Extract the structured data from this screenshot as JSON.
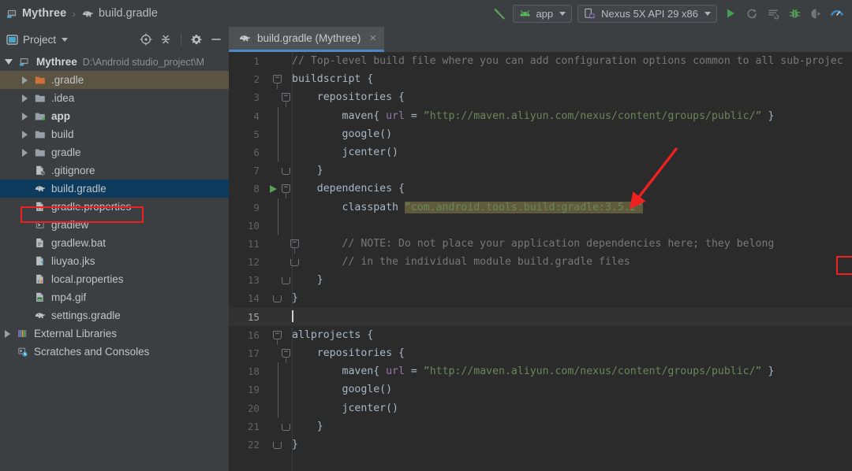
{
  "breadcrumb": {
    "project": "Mythree",
    "separator": "›",
    "file": "build.gradle",
    "project_icon": "module-icon",
    "file_icon": "gradle-elephant-icon"
  },
  "toolbar": {
    "build_icon": "hammer-icon",
    "run_config": {
      "label": "app",
      "icon": "android-head-icon",
      "caret": "chevron-down-icon"
    },
    "device": {
      "label": "Nexus 5X API 29 x86",
      "icon": "device-phone-icon",
      "caret": "chevron-down-icon"
    },
    "actions": [
      {
        "name": "run-button",
        "icon": "play-icon",
        "color": "#499c54"
      },
      {
        "name": "apply-changes-button",
        "icon": "apply-changes-icon",
        "color": "#6e7275"
      },
      {
        "name": "apply-code-changes-button",
        "icon": "apply-code-changes-icon",
        "color": "#6e7275"
      },
      {
        "name": "debug-button",
        "icon": "bug-icon",
        "color": "#57965c"
      },
      {
        "name": "attach-debugger-button",
        "icon": "attach-debugger-icon",
        "color": "#6e7275"
      },
      {
        "name": "profiler-button",
        "icon": "profiler-gauge-icon",
        "color": "#3d8ac4"
      }
    ]
  },
  "panel": {
    "title": "Project",
    "caret": "chevron-down-icon",
    "tools": [
      {
        "name": "select-opened-file-button",
        "icon": "target-crosshair-icon"
      },
      {
        "name": "collapse-all-button",
        "icon": "collapse-all-icon"
      },
      {
        "name": "settings-button",
        "icon": "gear-icon"
      },
      {
        "name": "hide-button",
        "icon": "minimize-icon"
      }
    ],
    "tree": [
      {
        "label": "Mythree",
        "path": "D:\\Android studio_project\\M",
        "icon": "module-icon",
        "expander": "down",
        "indent": 0,
        "bold": true,
        "state": "normal"
      },
      {
        "label": ".gradle",
        "icon": "folder-orange-icon",
        "expander": "right",
        "indent": 1,
        "bold": false,
        "state": "hover"
      },
      {
        "label": ".idea",
        "icon": "folder-icon",
        "expander": "right",
        "indent": 1,
        "bold": false,
        "state": "normal"
      },
      {
        "label": "app",
        "icon": "folder-module-icon",
        "expander": "right",
        "indent": 1,
        "bold": true,
        "state": "normal"
      },
      {
        "label": "build",
        "icon": "folder-icon",
        "expander": "right",
        "indent": 1,
        "bold": false,
        "state": "normal"
      },
      {
        "label": "gradle",
        "icon": "folder-icon",
        "expander": "right",
        "indent": 1,
        "bold": false,
        "state": "normal"
      },
      {
        "label": ".gitignore",
        "icon": "gitignore-file-icon",
        "expander": "none",
        "indent": 1,
        "bold": false,
        "state": "normal"
      },
      {
        "label": "build.gradle",
        "icon": "gradle-elephant-icon",
        "expander": "none",
        "indent": 1,
        "bold": false,
        "state": "selected"
      },
      {
        "label": "gradle.properties",
        "icon": "properties-file-icon",
        "expander": "none",
        "indent": 1,
        "bold": false,
        "state": "normal"
      },
      {
        "label": "gradlew",
        "icon": "script-file-icon",
        "expander": "none",
        "indent": 1,
        "bold": false,
        "state": "normal"
      },
      {
        "label": "gradlew.bat",
        "icon": "bat-file-icon",
        "expander": "none",
        "indent": 1,
        "bold": false,
        "state": "normal"
      },
      {
        "label": "liuyao.jks",
        "icon": "unknown-file-icon",
        "expander": "none",
        "indent": 1,
        "bold": false,
        "state": "normal"
      },
      {
        "label": "local.properties",
        "icon": "properties-file-icon",
        "expander": "none",
        "indent": 1,
        "bold": false,
        "state": "normal"
      },
      {
        "label": "mp4.gif",
        "icon": "image-file-icon",
        "expander": "none",
        "indent": 1,
        "bold": false,
        "state": "normal"
      },
      {
        "label": "settings.gradle",
        "icon": "gradle-elephant-icon",
        "expander": "none",
        "indent": 1,
        "bold": false,
        "state": "normal"
      },
      {
        "label": "External Libraries",
        "icon": "libraries-icon",
        "expander": "right",
        "indent": 0,
        "bold": false,
        "state": "normal"
      },
      {
        "label": "Scratches and Consoles",
        "icon": "scratches-icon",
        "expander": "none",
        "indent": 0,
        "bold": false,
        "state": "normal"
      }
    ]
  },
  "editor": {
    "tab": {
      "label": "build.gradle (Mythree)",
      "icon": "gradle-elephant-icon",
      "close": "×"
    },
    "lines": [
      {
        "n": "1",
        "segments": [
          {
            "t": "// Top-level build file where you can add configuration options common to all sub-projec",
            "c": "c-cmt"
          }
        ]
      },
      {
        "n": "2",
        "segments": [
          {
            "t": "buildscript {",
            "c": "c-pln"
          }
        ]
      },
      {
        "n": "3",
        "segments": [
          {
            "t": "    repositories {",
            "c": "c-pln"
          }
        ]
      },
      {
        "n": "4",
        "segments": [
          {
            "t": "        maven",
            "c": "c-pln"
          },
          {
            "t": "{ ",
            "c": "c-punc"
          },
          {
            "t": "url",
            "c": "c-attr"
          },
          {
            "t": " = ",
            "c": "c-pln"
          },
          {
            "t": "”http://maven.aliyun.com/nexus/content/groups/public/”",
            "c": "c-str"
          },
          {
            "t": " }",
            "c": "c-punc"
          }
        ]
      },
      {
        "n": "5",
        "segments": [
          {
            "t": "        google()",
            "c": "c-pln"
          }
        ]
      },
      {
        "n": "6",
        "segments": [
          {
            "t": "        jcenter()",
            "c": "c-pln"
          }
        ]
      },
      {
        "n": "7",
        "segments": [
          {
            "t": "    }",
            "c": "c-pln"
          }
        ]
      },
      {
        "n": "8",
        "segments": [
          {
            "t": "    dependencies {",
            "c": "c-pln"
          }
        ]
      },
      {
        "n": "9",
        "segments": [
          {
            "t": "        classpath ",
            "c": "c-pln"
          },
          {
            "t": "”com.android.tools.build:gradle:3.5.2”",
            "c": "c-str sel"
          }
        ]
      },
      {
        "n": "10",
        "segments": [
          {
            "t": "",
            "c": "c-pln"
          }
        ]
      },
      {
        "n": "11",
        "segments": [
          {
            "t": "        // NOTE: Do not place your application dependencies here; they belong",
            "c": "c-cmt"
          }
        ]
      },
      {
        "n": "12",
        "segments": [
          {
            "t": "        // in the individual module build.gradle files",
            "c": "c-cmt"
          }
        ]
      },
      {
        "n": "13",
        "segments": [
          {
            "t": "    }",
            "c": "c-pln"
          }
        ]
      },
      {
        "n": "14",
        "segments": [
          {
            "t": "}",
            "c": "c-pln"
          }
        ]
      },
      {
        "n": "15",
        "segments": [
          {
            "t": "",
            "c": "c-pln"
          }
        ]
      },
      {
        "n": "16",
        "segments": [
          {
            "t": "allprojects {",
            "c": "c-pln"
          }
        ]
      },
      {
        "n": "17",
        "segments": [
          {
            "t": "    repositories {",
            "c": "c-pln"
          }
        ]
      },
      {
        "n": "18",
        "segments": [
          {
            "t": "        maven",
            "c": "c-pln"
          },
          {
            "t": "{ ",
            "c": "c-punc"
          },
          {
            "t": "url",
            "c": "c-attr"
          },
          {
            "t": " = ",
            "c": "c-pln"
          },
          {
            "t": "”http://maven.aliyun.com/nexus/content/groups/public/”",
            "c": "c-str"
          },
          {
            "t": " }",
            "c": "c-punc"
          }
        ]
      },
      {
        "n": "19",
        "segments": [
          {
            "t": "        google()",
            "c": "c-pln"
          }
        ]
      },
      {
        "n": "20",
        "segments": [
          {
            "t": "        jcenter()",
            "c": "c-pln"
          }
        ]
      },
      {
        "n": "21",
        "segments": [
          {
            "t": "    }",
            "c": "c-pln"
          }
        ]
      },
      {
        "n": "22",
        "segments": [
          {
            "t": "}",
            "c": "c-pln"
          }
        ]
      }
    ],
    "cursor_line": "15",
    "gutter_run_marker_line": "8",
    "highlighted_version": "3.5.2"
  },
  "annotations": {
    "arrow_color": "#ee2020",
    "code_box_target": "3.5.2",
    "tree_box_target": "build.gradle"
  },
  "colors": {
    "editor_bg": "#2b2b2b",
    "chrome_bg": "#3c3f41",
    "selection_bg": "#5f5a3c",
    "tree_selection": "#0d3b5e",
    "tab_underline": "#4a88c7",
    "accent_green": "#499c54",
    "annotation_red": "#ee2020"
  }
}
